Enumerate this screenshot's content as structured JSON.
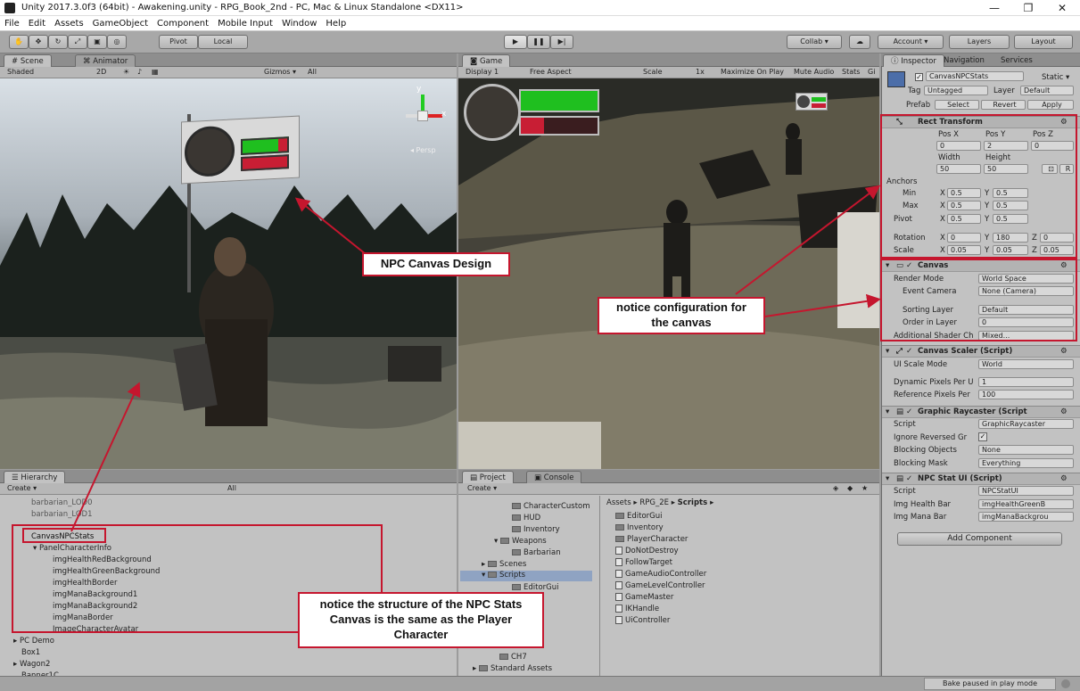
{
  "window": {
    "title": "Unity 2017.3.0f3 (64bit) - Awakening.unity - RPG_Book_2nd - PC, Mac & Linux Standalone <DX11>",
    "controls": [
      "—",
      "❐",
      "✕"
    ]
  },
  "menu": [
    "File",
    "Edit",
    "Assets",
    "GameObject",
    "Component",
    "Mobile Input",
    "Window",
    "Help"
  ],
  "toolbar": {
    "pivot": "Pivot",
    "local": "Local",
    "collab": "Collab ▾",
    "account": "Account ▾",
    "layers": "Layers",
    "layout": "Layout"
  },
  "scene": {
    "tabs": [
      "Scene",
      "Animator"
    ],
    "shading": "Shaded",
    "mode2d": "2D",
    "gizmos": "Gizmos ▾",
    "search": "All",
    "persp": "◂ Persp"
  },
  "game": {
    "tabs": [
      "Game"
    ],
    "display": "Display 1",
    "aspect": "Free Aspect",
    "scale": "Scale",
    "scale_value": "1x",
    "options": [
      "Maximize On Play",
      "Mute Audio",
      "Stats",
      "Gi"
    ]
  },
  "hierarchy": {
    "tabs": [
      "Hierarchy"
    ],
    "create": "Create ▾",
    "search": "All",
    "items": [
      "barbarian_LOD0",
      "barbarian_LOD1",
      "CanvasNPCStats",
      "PanelCharacterInfo",
      "imgHealthRedBackground",
      "imgHealthGreenBackground",
      "imgHealthBorder",
      "imgManaBackground1",
      "imgManaBackground2",
      "imgManaBorder",
      "ImageCharacterAvatar",
      "PC Demo",
      "Box1",
      "Wagon2",
      "Banner1C"
    ]
  },
  "project": {
    "tabs": [
      "Project",
      "Console"
    ],
    "create": "Create ▾",
    "folders": [
      "CharacterCustom",
      "HUD",
      "Inventory",
      "Weapons",
      "Barbarian",
      "Scenes",
      "Scripts",
      "EditorGui",
      "CH7",
      "Standard Assets"
    ],
    "breadcrumb": [
      "Assets ▸",
      "RPG_2E ▸",
      "Scripts ▸"
    ],
    "files": [
      "EditorGui",
      "Inventory",
      "PlayerCharacter",
      "DoNotDestroy",
      "FollowTarget",
      "GameAudioController",
      "GameLevelController",
      "GameMaster",
      "IKHandle",
      "UiController"
    ]
  },
  "inspector": {
    "tabs": [
      "Inspector",
      "Navigation",
      "Services"
    ],
    "object_name": "CanvasNPCStats",
    "static": "Static ▾",
    "tag_label": "Tag",
    "tag_value": "Untagged",
    "layer_label": "Layer",
    "layer_value": "Default",
    "prefab": [
      "Prefab",
      "Select",
      "Revert",
      "Apply"
    ],
    "rect_transform": {
      "title": "Rect Transform",
      "headers": [
        "Pos X",
        "Pos Y",
        "Pos Z"
      ],
      "pos": [
        "0",
        "2",
        "0"
      ],
      "size_headers": [
        "Width",
        "Height"
      ],
      "size": [
        "50",
        "50"
      ],
      "anchors": "Anchors",
      "min_label": "Min",
      "max_label": "Max",
      "pivot_label": "Pivot",
      "anchor_min": [
        "0.5",
        "0.5"
      ],
      "anchor_max": [
        "0.5",
        "0.5"
      ],
      "pivot": [
        "0.5",
        "0.5"
      ],
      "rotation_label": "Rotation",
      "rotation": [
        "0",
        "180",
        "0"
      ],
      "scale_label": "Scale",
      "scale": [
        "0.05",
        "0.05",
        "0.05"
      ]
    },
    "canvas": {
      "title": "Canvas",
      "render_mode_label": "Render Mode",
      "render_mode": "World Space",
      "event_camera_label": "Event Camera",
      "event_camera": "None (Camera)",
      "sorting_layer_label": "Sorting Layer",
      "sorting_layer": "Default",
      "order_label": "Order in Layer",
      "order": "0",
      "shader_label": "Additional Shader Ch",
      "shader": "Mixed..."
    },
    "canvas_scaler": {
      "title": "Canvas Scaler (Script)",
      "ui_scale_label": "UI Scale Mode",
      "ui_scale": "World",
      "dynamic_label": "Dynamic Pixels Per U",
      "dynamic": "1",
      "reference_label": "Reference Pixels Per",
      "reference": "100"
    },
    "graphic_raycaster": {
      "title": "Graphic Raycaster (Script",
      "script_label": "Script",
      "script": "GraphicRaycaster",
      "ignore_label": "Ignore Reversed Gr",
      "blocking_objects_label": "Blocking Objects",
      "blocking_objects": "None",
      "blocking_mask_label": "Blocking Mask",
      "blocking_mask": "Everything"
    },
    "npc_stat_ui": {
      "title": "NPC Stat UI (Script)",
      "script_label": "Script",
      "script": "NPCStatUI",
      "health_label": "Img Health Bar",
      "health": "imgHealthGreenB",
      "mana_label": "Img Mana Bar",
      "mana": "imgManaBackgrou"
    },
    "add_component": "Add Component"
  },
  "annotations": {
    "npc_canvas": "NPC Canvas Design",
    "configuration": "notice configuration for the canvas",
    "structure": "notice the structure of the NPC Stats Canvas is the same as the Player Character"
  },
  "status": "Bake paused in play mode",
  "colors": {
    "annotation_red": "#c5162e",
    "health_green": "#1fbf1f",
    "health_red": "#c81e34"
  }
}
